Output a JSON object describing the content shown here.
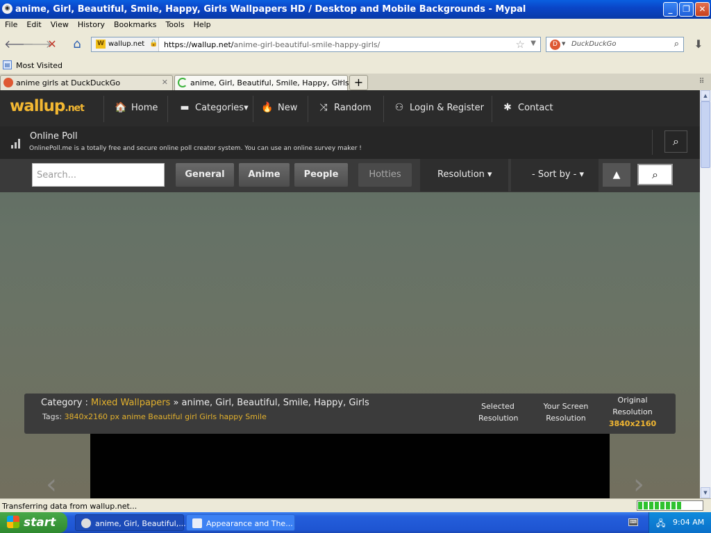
{
  "window": {
    "title": "anime, Girl, Beautiful, Smile, Happy, Girls Wallpapers HD / Desktop and Mobile Backgrounds - Mypal",
    "app_icon": "mypal-icon",
    "minimize": "_",
    "maximize": "❐",
    "close": "✕"
  },
  "menu": [
    "File",
    "Edit",
    "View",
    "History",
    "Bookmarks",
    "Tools",
    "Help"
  ],
  "navbar": {
    "back_icon": "🡐",
    "forward_icon": "🡒",
    "stop_icon": "✕",
    "home_icon": "⌂",
    "site_identity": "wallup.net",
    "url_host": "https://wallup.net/",
    "url_path": "anime-girl-beautiful-smile-happy-girls/",
    "bookmark_star": "☆",
    "url_dropdown": "▼",
    "search_engine": "DuckDuckGo",
    "download_icon": "⬇"
  },
  "bookmarks": {
    "most_visited": "Most Visited"
  },
  "tabs": [
    {
      "label": "anime girls at DuckDuckGo",
      "close": "✕"
    },
    {
      "label": "anime, Girl, Beautiful, Smile, Happy, Girls ...",
      "close": "✕"
    }
  ],
  "new_tab": "+",
  "site": {
    "logo_main": "wallup",
    "logo_tld": ".net",
    "nav": [
      {
        "icon": "home-icon",
        "glyph": "🏠",
        "label": "Home"
      },
      {
        "icon": "folder-icon",
        "glyph": "▬",
        "label": "Categories",
        "caret": "▾"
      },
      {
        "icon": "fire-icon",
        "glyph": "🔥",
        "label": "New"
      },
      {
        "icon": "shuffle-icon",
        "glyph": "⤨",
        "label": "Random"
      },
      {
        "icon": "user-login-icon",
        "glyph": "⚇",
        "label": "Login & Register"
      },
      {
        "icon": "contact-icon",
        "glyph": "✱",
        "label": "Contact"
      }
    ],
    "poll_title": "Online Poll",
    "poll_desc": "OnlinePoll.me is a totally free and secure online poll creator system. You can use an online survey maker !",
    "search_placeholder": "Search...",
    "filters": [
      "General",
      "Anime",
      "People",
      "Hotties"
    ],
    "resolution_label": "Resolution ▾",
    "sort_label": "- Sort by - ▾",
    "up_icon": "▲",
    "find_icon": "⌕",
    "category_prefix": "Category : ",
    "category_link": "Mixed Wallpapers",
    "category_rest": " » anime, Girl, Beautiful, Smile, Happy, Girls",
    "tags_prefix": "Tags: ",
    "tags": "3840x2160 px anime Beautiful girl Girls happy Smile",
    "selected_res_1": "Selected",
    "selected_res_2": "Resolution",
    "your_res_1": "Your Screen",
    "your_res_2": "Resolution",
    "original_res_1": "Original",
    "original_res_2": "Resolution",
    "original_res_value": "3840x2160",
    "prev_arrow": "‹",
    "next_arrow": "›"
  },
  "status": {
    "text": "Transferring data from wallup.net...",
    "progress": 0.7
  },
  "taskbar": {
    "start": "start",
    "tasks": [
      {
        "label": "anime, Girl, Beautiful,..."
      },
      {
        "label": "Appearance and The..."
      }
    ],
    "clock": "9:04 AM",
    "tray_keyboard": "⌨"
  },
  "colors": {
    "accent": "#f2b732",
    "link": "#e3b12d",
    "xp_blue": "#245edb"
  }
}
